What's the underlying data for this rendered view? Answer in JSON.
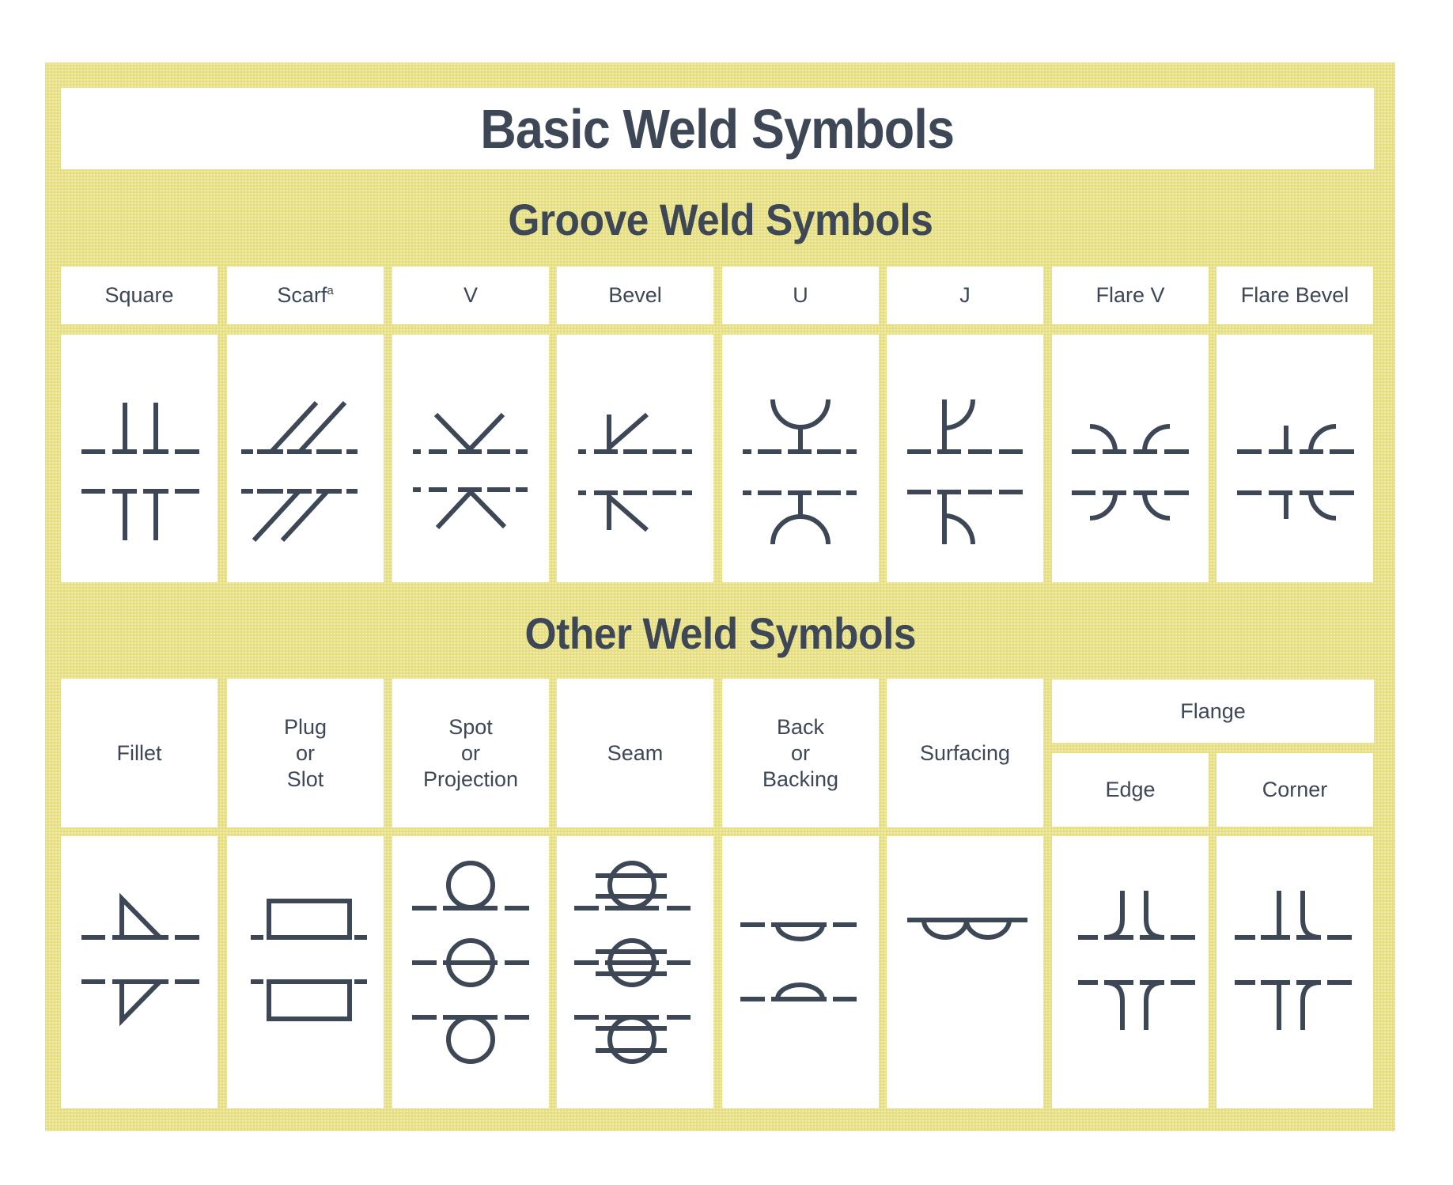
{
  "title": "Basic Weld Symbols",
  "colors": {
    "background": "#e6df82",
    "ink": "#3d4756",
    "cell": "#ffffff"
  },
  "groove": {
    "heading": "Groove Weld Symbols",
    "columns": [
      {
        "label": "Square",
        "symbol": "square"
      },
      {
        "label": "Scarf",
        "superscript": "a",
        "symbol": "scarf"
      },
      {
        "label": "V",
        "symbol": "v"
      },
      {
        "label": "Bevel",
        "symbol": "bevel"
      },
      {
        "label": "U",
        "symbol": "u"
      },
      {
        "label": "J",
        "symbol": "j"
      },
      {
        "label": "Flare V",
        "symbol": "flare-v"
      },
      {
        "label": "Flare Bevel",
        "symbol": "flare-bevel"
      }
    ]
  },
  "other": {
    "heading": "Other Weld Symbols",
    "columns": [
      {
        "label_lines": [
          "Fillet"
        ],
        "symbol": "fillet"
      },
      {
        "label_lines": [
          "Plug",
          "or",
          "Slot"
        ],
        "symbol": "plug"
      },
      {
        "label_lines": [
          "Spot",
          "or",
          "Projection"
        ],
        "symbol": "spot"
      },
      {
        "label_lines": [
          "Seam"
        ],
        "symbol": "seam"
      },
      {
        "label_lines": [
          "Back",
          "or",
          "Backing"
        ],
        "symbol": "back"
      },
      {
        "label_lines": [
          "Surfacing"
        ],
        "symbol": "surfacing"
      }
    ],
    "flange": {
      "label": "Flange",
      "columns": [
        {
          "label": "Edge",
          "symbol": "flange-edge"
        },
        {
          "label": "Corner",
          "symbol": "flange-corner"
        }
      ]
    }
  }
}
